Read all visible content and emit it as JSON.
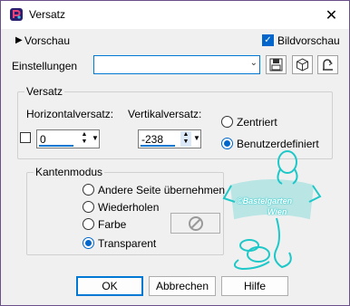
{
  "window": {
    "title": "Versatz",
    "close_glyph": "✕"
  },
  "preview": {
    "toggle_label": "Vorschau",
    "bildvorschau_label": "Bildvorschau",
    "bildvorschau_checked": true
  },
  "settings": {
    "label": "Einstellungen",
    "value": ""
  },
  "versatz": {
    "group_label": "Versatz",
    "horizontal_label": "Horizontalversatz:",
    "horizontal_value": "0",
    "vertical_label": "Vertikalversatz:",
    "vertical_value": "-238",
    "zentriert_label": "Zentriert",
    "benutzer_label": "Benutzerdefiniert",
    "selected": "Benutzerdefiniert"
  },
  "kantenmodus": {
    "group_label": "Kantenmodus",
    "options": [
      "Andere Seite übernehmen",
      "Wiederholen",
      "Farbe",
      "Transparent"
    ],
    "selected": "Transparent"
  },
  "watermark": {
    "line1": "©Bastelgarten",
    "line2": "Wien"
  },
  "buttons": {
    "ok": "OK",
    "cancel": "Abbrechen",
    "help": "Hilfe"
  },
  "colors": {
    "accent": "#0066cc",
    "watermark": "#1ec8c8"
  }
}
